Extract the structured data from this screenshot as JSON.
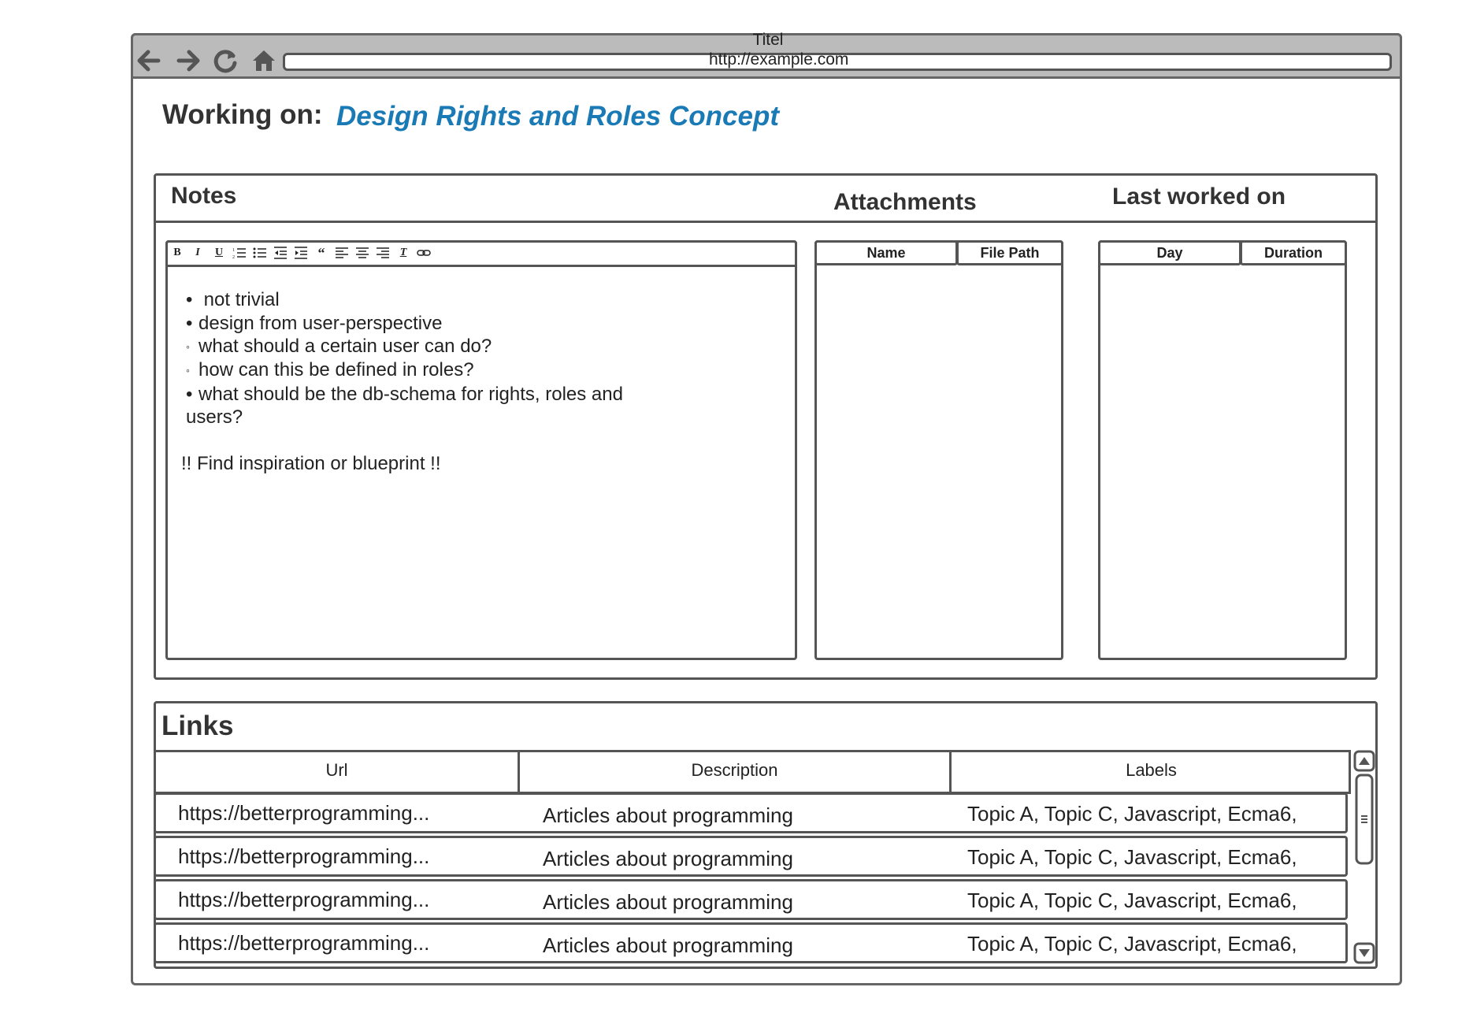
{
  "browser": {
    "window_title": "Titel",
    "url": "http://example.com",
    "nav": [
      "back-icon",
      "forward-icon",
      "reload-icon",
      "home-icon"
    ]
  },
  "header": {
    "label": "Working on:",
    "title": "Design Rights and Roles Concept"
  },
  "notes": {
    "heading": "Notes",
    "toolbar": [
      "B",
      "I",
      "U",
      "ordered-list-icon",
      "bullet-list-icon",
      "outdent-icon",
      "indent-icon",
      "quote-icon",
      "align-left-icon",
      "align-center-icon",
      "align-right-icon",
      "clear-format-icon",
      "link-icon"
    ],
    "content": {
      "item1": "not trivial",
      "item2": "design from user-perspective",
      "item2_sub1": "what should a certain user can do?",
      "item2_sub2": "how can this be defined in roles?",
      "item3_line1": "what should be the db-schema for rights, roles and",
      "item3_line2": "users?",
      "footer": "!! Find inspiration or blueprint !!"
    }
  },
  "attachments": {
    "heading": "Attachments",
    "columns": [
      "Name",
      "File Path"
    ]
  },
  "last_worked": {
    "heading": "Last worked on",
    "columns": [
      "Day",
      "Duration"
    ]
  },
  "links": {
    "heading": "Links",
    "columns": [
      "Url",
      "Description",
      "Labels"
    ],
    "rows": [
      {
        "url": "https://betterprogramming...",
        "description": "Articles about programming",
        "labels": "Topic A, Topic C, Javascript, Ecma6,"
      },
      {
        "url": "https://betterprogramming...",
        "description": "Articles about programming",
        "labels": "Topic A, Topic C, Javascript, Ecma6,"
      },
      {
        "url": "https://betterprogramming...",
        "description": "Articles about programming",
        "labels": "Topic A, Topic C, Javascript, Ecma6,"
      },
      {
        "url": "https://betterprogramming...",
        "description": "Articles about programming",
        "labels": "Topic A, Topic C, Javascript, Ecma6,"
      }
    ]
  },
  "colors": {
    "accent": "#1a7ab5",
    "chrome": "#bbbbbb",
    "border": "#555555"
  }
}
